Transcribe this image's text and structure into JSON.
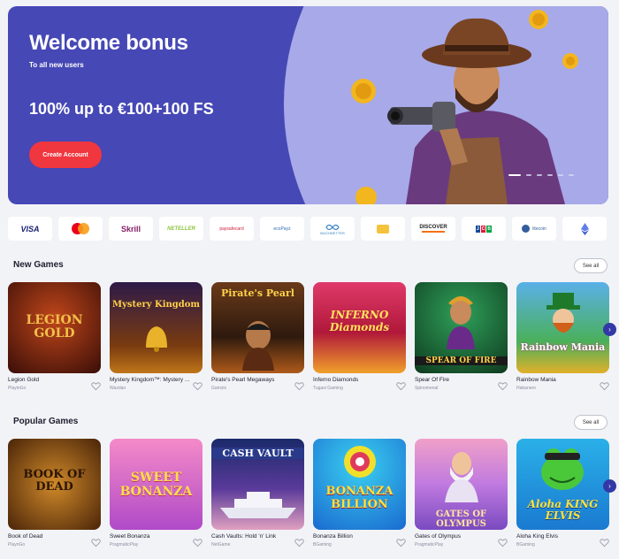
{
  "hero": {
    "title": "Welcome bonus",
    "subtitle": "To all new users",
    "offer": "100% up to €100+100 FS",
    "cta": "Create Account"
  },
  "payments": [
    {
      "label": "VISA",
      "icon": "visa-logo"
    },
    {
      "label": "",
      "icon": "mastercard-logo"
    },
    {
      "label": "Skrill",
      "icon": "skrill-logo"
    },
    {
      "label": "NETELLER",
      "icon": "neteller-logo"
    },
    {
      "label": "paysafecard",
      "icon": "paysafecard-logo"
    },
    {
      "label": "ecoPayz",
      "icon": "ecopayz-logo"
    },
    {
      "label": "MUCHBETTER",
      "icon": "muchbetter-logo"
    },
    {
      "label": "",
      "icon": "card-logo"
    },
    {
      "label": "DISCOVER",
      "icon": "discover-logo"
    },
    {
      "label": "JCB",
      "icon": "jcb-logo"
    },
    {
      "label": "litecoin",
      "icon": "litecoin-logo"
    },
    {
      "label": "",
      "icon": "ethereum-logo"
    }
  ],
  "new_games": {
    "title": "New Games",
    "see_all": "See all",
    "games": [
      {
        "name": "Legion Gold",
        "provider": "PlayinGo",
        "art": "LEGION GOLD"
      },
      {
        "name": "Mystery Kingdom™: Mystery ...",
        "provider": "Wazdan",
        "art": "Mystery Kingdom"
      },
      {
        "name": "Pirate's Pearl Megaways",
        "provider": "Gamzix",
        "art": "Pirate's Pearl"
      },
      {
        "name": "Inferno Diamonds",
        "provider": "Tugasi Gaming",
        "art": "INFERNO Diamonds"
      },
      {
        "name": "Spear Of Fire",
        "provider": "Spinomenal",
        "art": "SPEAR OF FIRE"
      },
      {
        "name": "Rainbow Mania",
        "provider": "Habanero",
        "art": "Rainbow Mania"
      }
    ]
  },
  "popular_games": {
    "title": "Popular Games",
    "see_all": "See all",
    "games": [
      {
        "name": "Book of Dead",
        "provider": "PlaynGo",
        "art": "BOOK OF DEAD"
      },
      {
        "name": "Sweet Bonanza",
        "provider": "PragmaticPlay",
        "art": "SWEET BONANZA"
      },
      {
        "name": "Cash Vaults: Hold 'n' Link",
        "provider": "NetGame",
        "art": "CASH VAULT"
      },
      {
        "name": "Bonanza Billion",
        "provider": "BGaming",
        "art": "BONANZA BILLION"
      },
      {
        "name": "Gates of Olympus",
        "provider": "PragmaticPlay",
        "art": "GATES OF OLYMPUS"
      },
      {
        "name": "Aloha King Elvis",
        "provider": "BGaming",
        "art": "Aloha KING ELVIS"
      }
    ]
  },
  "colors": {
    "accent": "#3438a6",
    "hero_bg": "#4648b5",
    "cta": "#f0363e"
  }
}
